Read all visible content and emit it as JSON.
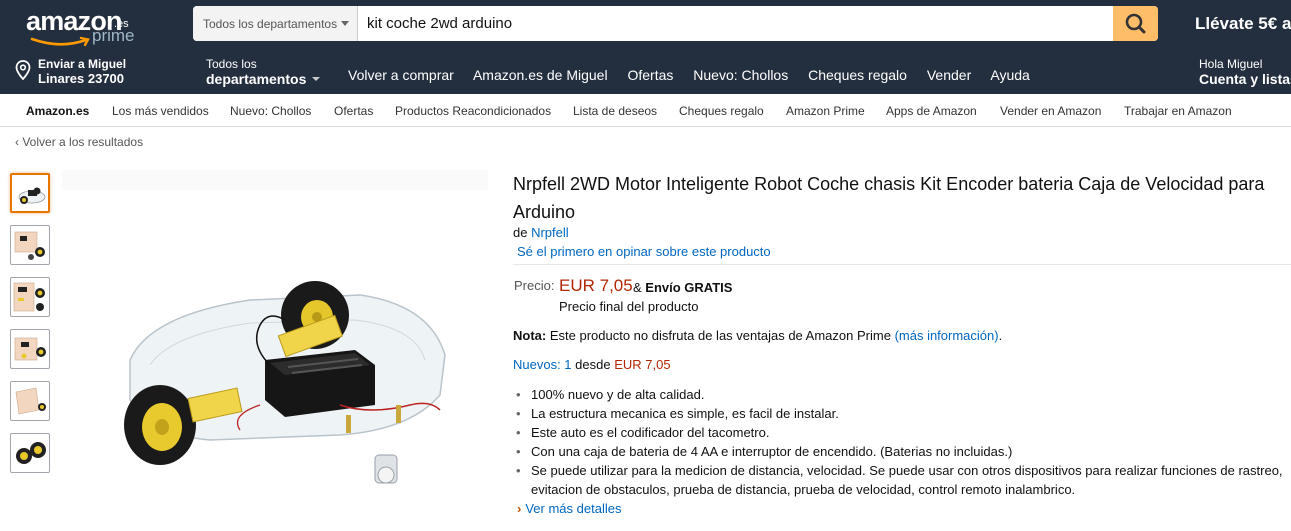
{
  "header": {
    "logo_word": "amazon",
    "logo_tld": ".es",
    "logo_prime": "prime",
    "search_dept": "Todos los departamentos",
    "search_value": "kit coche 2wd arduino",
    "promo": "Llévate 5€ a",
    "location_line1": "Enviar a Miguel",
    "location_line2": "Linares 23700",
    "alldept_line1": "Todos los",
    "alldept_line2": "departamentos",
    "nav_links": [
      "Volver a comprar",
      "Amazon.es de Miguel",
      "Ofertas",
      "Nuevo: Chollos",
      "Cheques regalo",
      "Vender",
      "Ayuda"
    ],
    "account_line1": "Hola Miguel",
    "account_line2": "Cuenta y listas",
    "colors": {
      "header_bg": "#232f3e",
      "search_button": "#febd69"
    }
  },
  "subnav": {
    "items": [
      "Amazon.es",
      "Los más vendidos",
      "Nuevo: Chollos",
      "Ofertas",
      "Productos Reacondicionados",
      "Lista de deseos",
      "Cheques regalo",
      "Amazon Prime",
      "Apps de Amazon",
      "Vender en Amazon",
      "Trabajar en Amazon"
    ]
  },
  "breadcrumb": {
    "back": "Volver a los resultados"
  },
  "gallery": {
    "thumbnail_icons": [
      "robot-car-thumb",
      "kit-parts-thumb",
      "kit-parts-thumb",
      "kit-parts-thumb",
      "chassis-plate-thumb",
      "wheels-thumb"
    ],
    "selected_index": 0,
    "main_image_icon": "robot-car-chassis-image"
  },
  "product": {
    "title": "Nrpfell 2WD Motor Inteligente Robot Coche chasis Kit Encoder bateria Caja de Velocidad para Arduino",
    "brand_prefix": "de",
    "brand": "Nrpfell",
    "review_link": "Sé el primero en opinar sobre este producto",
    "price_label": "Precio:",
    "price": "EUR 7,05",
    "shipping_amp": "&",
    "shipping": "Envío GRATIS",
    "price_final": "Precio final del producto",
    "note_label": "Nota:",
    "note_text": "Este producto no disfruta de las ventajas de Amazon Prime",
    "note_link": "(más información)",
    "note_end": ".",
    "nuevos_link": "Nuevos: 1",
    "nuevos_desde": "desde",
    "nuevos_price": "EUR 7,05",
    "bullets": [
      "100% nuevo y de alta calidad.",
      "La estructura mecanica es simple, es facil de instalar.",
      "Este auto es el codificador del tacometro.",
      "Con una caja de bateria de 4 AA e interruptor de encendido. (Baterias no incluidas.)",
      "Se puede utilizar para la medicion de distancia, velocidad. Se puede usar con otros dispositivos para realizar funciones de rastreo, evitacion de obstaculos, prueba de distancia, prueba de velocidad, control remoto inalambrico."
    ],
    "more_details": "Ver más detalles",
    "colors": {
      "price": "#b12704",
      "link": "#0066c0"
    }
  }
}
